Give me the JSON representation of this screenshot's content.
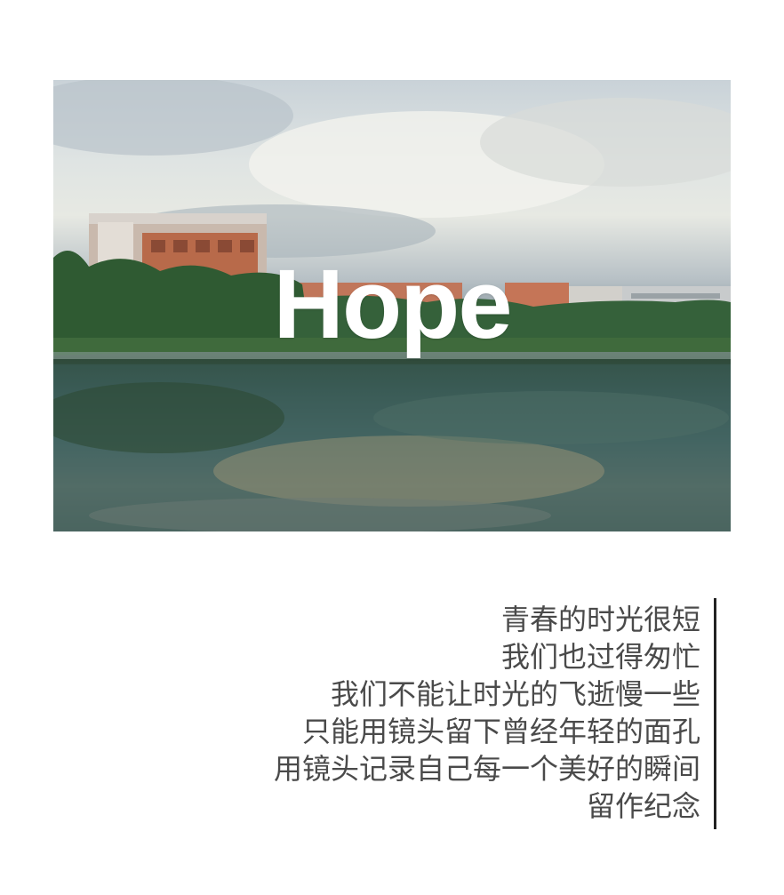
{
  "photo": {
    "title": "Hope",
    "description_icon": "campus-lake-photo"
  },
  "poem": {
    "lines": [
      "青春的时光很短",
      "我们也过得匆忙",
      "我们不能让时光的飞逝慢一些",
      "只能用镜头留下曾经年轻的面孔",
      "用镜头记录自己每一个美好的瞬间",
      "留作纪念"
    ]
  },
  "colors": {
    "background": "#ffffff",
    "title_text": "#ffffff",
    "poem_text": "#4a4a4a",
    "accent_bar": "#222222"
  }
}
